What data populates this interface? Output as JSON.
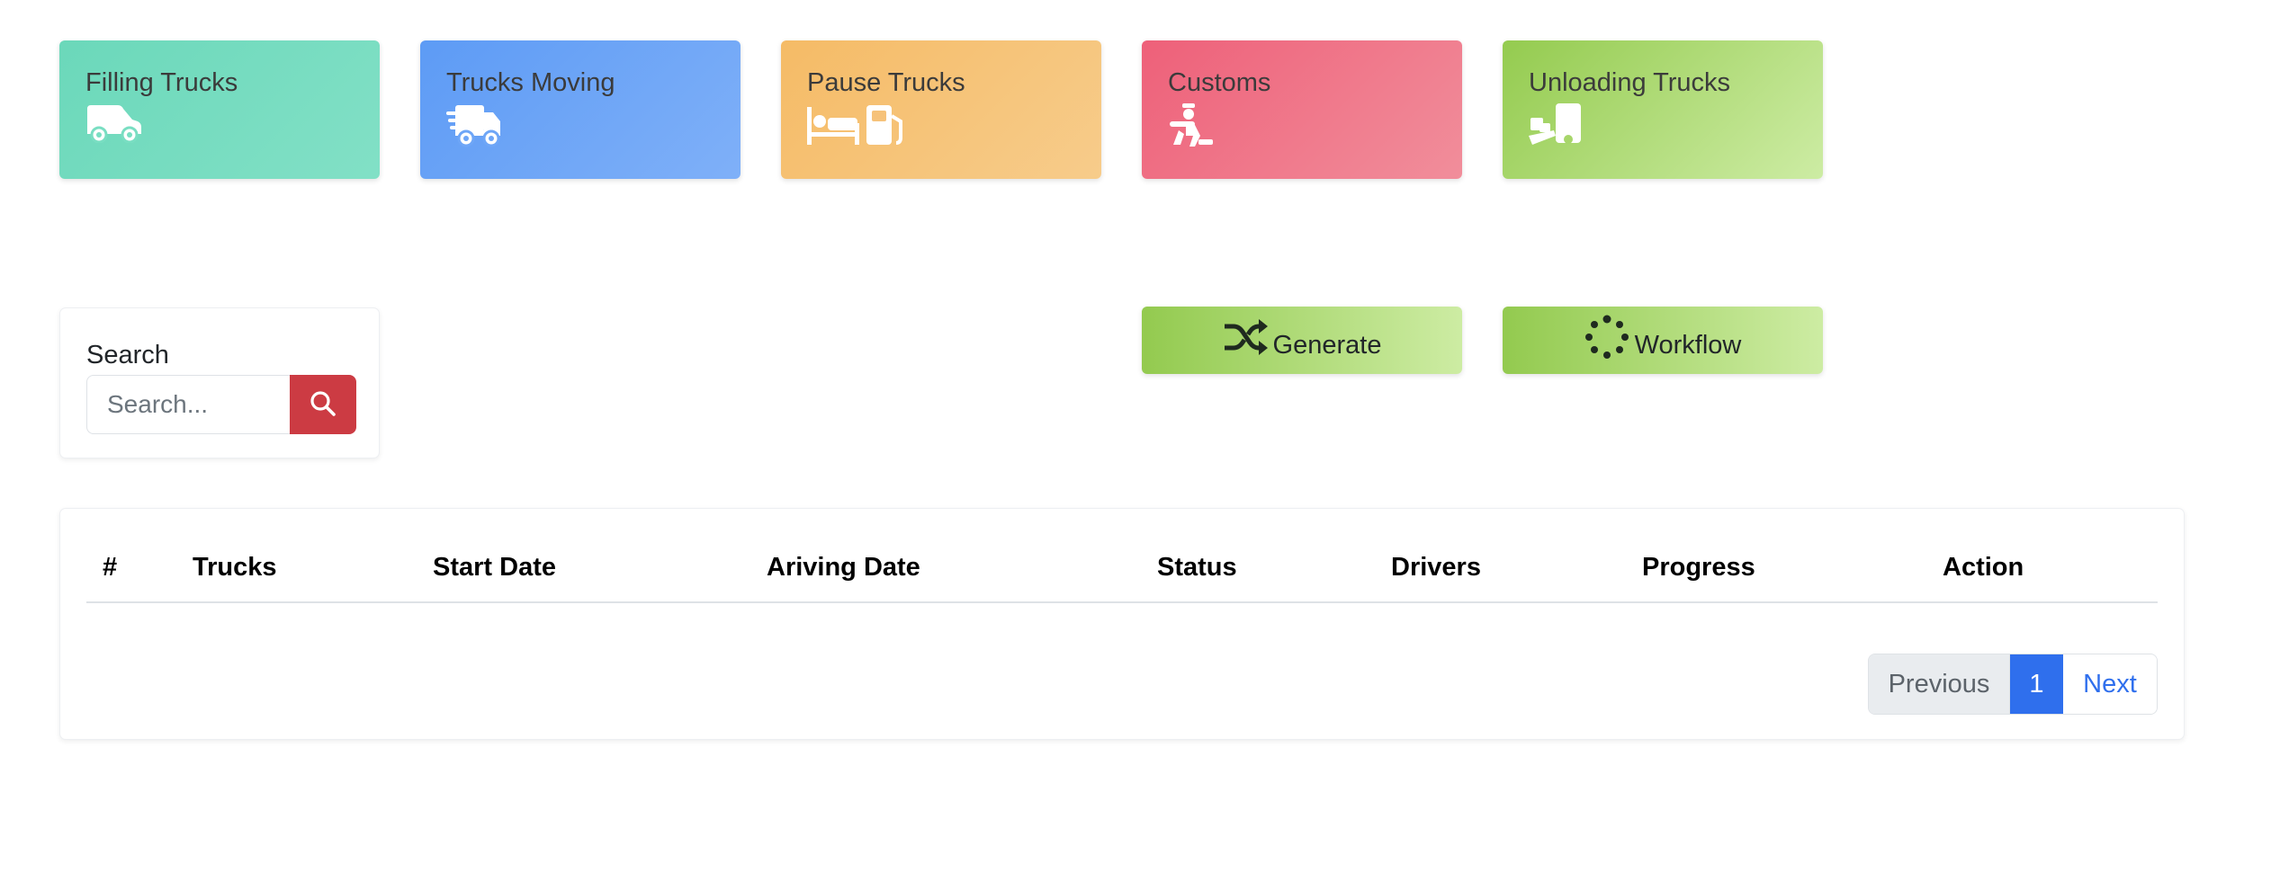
{
  "stat_cards": [
    {
      "label": "Filling Trucks",
      "icon": "van-icon",
      "color": "#6bd8ba"
    },
    {
      "label": "Trucks Moving",
      "icon": "truck-fast-icon",
      "color": "#5d9bf5"
    },
    {
      "label": "Pause Trucks",
      "icon": "bed-and-gas-pump-icon",
      "color": "#f5bb66"
    },
    {
      "label": "Customs",
      "icon": "person-hand-truck-icon",
      "color": "#ee6079"
    },
    {
      "label": "Unloading Trucks",
      "icon": "hand-holding-box-icon",
      "color": "#94cb4f"
    }
  ],
  "search": {
    "title": "Search",
    "placeholder": "Search...",
    "button_icon": "search-icon",
    "button_color": "#cc3b43"
  },
  "actions": {
    "generate": {
      "label": "Generate",
      "icon": "shuffle-icon"
    },
    "workflow": {
      "label": "Workflow",
      "icon": "spinner-icon"
    }
  },
  "table": {
    "headers": [
      "#",
      "Trucks",
      "Start Date",
      "Ariving Date",
      "Status",
      "Drivers",
      "Progress",
      "Action"
    ],
    "rows": []
  },
  "pagination": {
    "previous": "Previous",
    "current": "1",
    "next": "Next",
    "active_color": "#2f6fed"
  }
}
